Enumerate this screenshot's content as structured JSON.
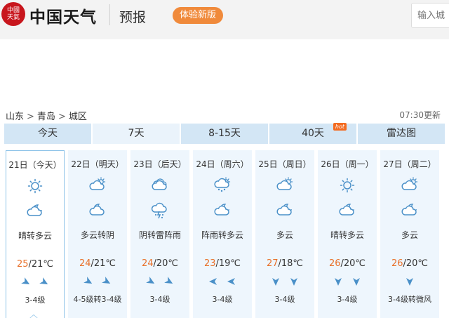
{
  "header": {
    "logo_seal_text": "中國天氣",
    "brand": "中国天气",
    "section_title": "预报",
    "new_version_badge": "体验新版",
    "search_placeholder": "输入城"
  },
  "breadcrumb": {
    "items": [
      "山东",
      "青岛",
      "城区"
    ],
    "separator": ">"
  },
  "update_time": "07:30更新",
  "tabs": [
    {
      "label": "今天"
    },
    {
      "label": "7天"
    },
    {
      "label": "8-15天"
    },
    {
      "label": "40天",
      "badge": "hot"
    },
    {
      "label": "雷达图"
    }
  ],
  "colors": {
    "accent_blue": "#4a90c8",
    "high_temp": "#e8702a",
    "badge_orange": "#f08a3b",
    "tab_bg": "#d3e6f5",
    "card_bg": "#eef6fd"
  },
  "days": [
    {
      "date": "21日（今天）",
      "day_icon": "sunny-icon",
      "night_icon": "night-cloudy-icon",
      "desc": "晴转多云",
      "high": "25",
      "low": "/21℃",
      "wind_dirs": [
        "northeast-wind-icon",
        "northeast-wind-icon"
      ],
      "wind_level": "3-4级"
    },
    {
      "date": "22日（明天）",
      "day_icon": "partly-cloudy-icon",
      "night_icon": "night-overcast-icon",
      "desc": "多云转阴",
      "high": "24",
      "low": "/21℃",
      "wind_dirs": [
        "northeast-wind-icon",
        "northeast-wind-icon"
      ],
      "wind_level": "4-5级转3-4级"
    },
    {
      "date": "23日（后天）",
      "day_icon": "overcast-icon",
      "night_icon": "thunderstorm-icon",
      "desc": "阴转雷阵雨",
      "high": "24",
      "low": "/20℃",
      "wind_dirs": [
        "northeast-wind-icon",
        "northeast-wind-icon"
      ],
      "wind_level": "3-4级"
    },
    {
      "date": "24日（周六）",
      "day_icon": "shower-icon",
      "night_icon": "night-cloudy-icon",
      "desc": "阵雨转多云",
      "high": "23",
      "low": "/19℃",
      "wind_dirs": [
        "east-wind-icon",
        "east-wind-icon"
      ],
      "wind_level": "3-4级"
    },
    {
      "date": "25日（周日）",
      "day_icon": "partly-cloudy-icon",
      "night_icon": "night-cloudy-icon",
      "desc": "多云",
      "high": "27",
      "low": "/18℃",
      "wind_dirs": [
        "south-wind-icon",
        "south-wind-icon"
      ],
      "wind_level": "3-4级"
    },
    {
      "date": "26日（周一）",
      "day_icon": "sunny-icon",
      "night_icon": "night-cloudy-icon",
      "desc": "晴转多云",
      "high": "26",
      "low": "/20℃",
      "wind_dirs": [
        "south-wind-icon",
        "south-wind-icon"
      ],
      "wind_level": "3-4级"
    },
    {
      "date": "27日（周二）",
      "day_icon": "partly-cloudy-icon",
      "night_icon": "night-cloudy-icon",
      "desc": "多云",
      "high": "26",
      "low": "/20℃",
      "wind_dirs": [
        "south-wind-icon"
      ],
      "wind_level": "3-4级转微风"
    }
  ]
}
